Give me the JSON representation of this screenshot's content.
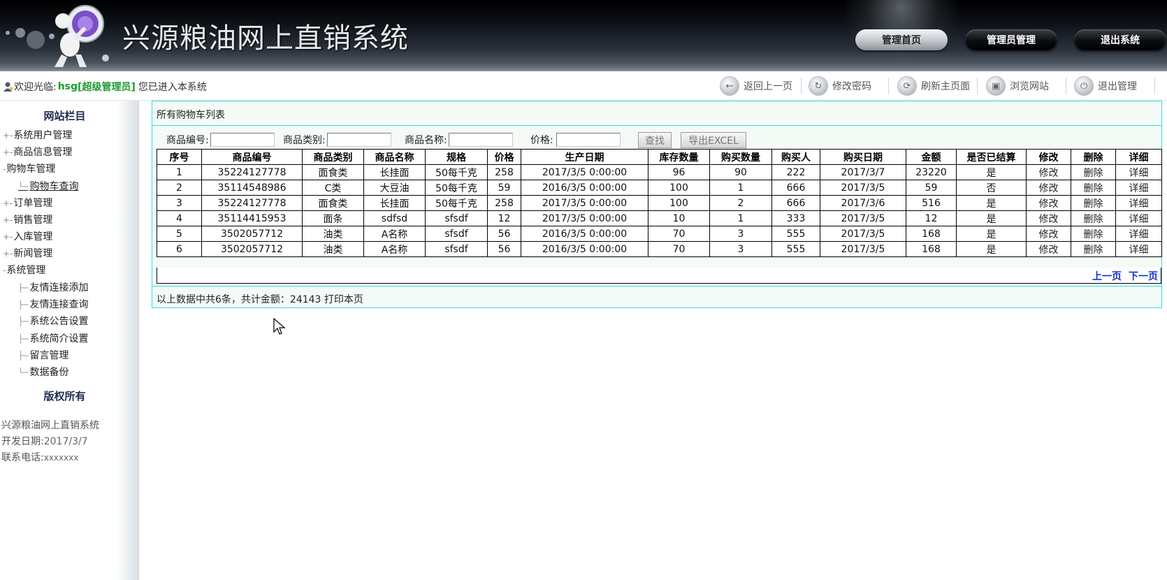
{
  "header": {
    "title": "兴源粮油网上直销系统",
    "nav": [
      "管理首页",
      "管理员管理",
      "退出系统"
    ]
  },
  "infobar": {
    "welcome_prefix": "欢迎光临:",
    "username": "hsg",
    "role": "[超级管理员]",
    "welcome_suffix": "您已进入本系统",
    "tools": [
      {
        "label": "返回上一页",
        "icon": "back-arrow-icon"
      },
      {
        "label": "修改密码",
        "icon": "refresh-key-icon"
      },
      {
        "label": "刷新主页面",
        "icon": "refresh-icon"
      },
      {
        "label": "浏览网站",
        "icon": "browse-icon"
      },
      {
        "label": "退出管理",
        "icon": "power-icon"
      }
    ]
  },
  "sidebar": {
    "title": "网站栏目",
    "items": [
      "系统用户管理",
      "商品信息管理",
      "购物车管理",
      "购物车查询",
      "订单管理",
      "销售管理",
      "入库管理",
      "新闻管理",
      "系统管理"
    ],
    "sub_items": [
      "友情连接添加",
      "友情连接查询",
      "系统公告设置",
      "系统简介设置",
      "留言管理",
      "数据备份"
    ],
    "copyright": "版权所有",
    "footer": {
      "system": "兴源粮油网上直销系统",
      "dev_date_label": "开发日期:",
      "dev_date": "2017/3/7",
      "phone_label": "联系电话:",
      "phone": "xxxxxxx"
    }
  },
  "main": {
    "panel_title": "所有购物车列表",
    "search": {
      "fields": [
        "商品编号:",
        "商品类别:",
        "商品名称:",
        "价格:"
      ],
      "search_button": "查找",
      "export_button": "导出EXCEL"
    },
    "table": {
      "columns": [
        "序号",
        "商品编号",
        "商品类别",
        "商品名称",
        "规格",
        "价格",
        "生产日期",
        "库存数量",
        "购买数量",
        "购买人",
        "购买日期",
        "金额",
        "是否已结算",
        "修改",
        "删除",
        "详细"
      ],
      "rows": [
        [
          "1",
          "35224127778",
          "面食类",
          "长挂面",
          "50每千克",
          "258",
          "2017/3/5 0:00:00",
          "96",
          "90",
          "222",
          "2017/3/7",
          "23220",
          "是",
          "修改",
          "删除",
          "详细"
        ],
        [
          "2",
          "35114548986",
          "C类",
          "大豆油",
          "50每千克",
          "59",
          "2016/3/5 0:00:00",
          "100",
          "1",
          "666",
          "2017/3/5",
          "59",
          "否",
          "修改",
          "删除",
          "详细"
        ],
        [
          "3",
          "35224127778",
          "面食类",
          "长挂面",
          "50每千克",
          "258",
          "2017/3/5 0:00:00",
          "100",
          "2",
          "666",
          "2017/3/6",
          "516",
          "是",
          "修改",
          "删除",
          "详细"
        ],
        [
          "4",
          "35114415953",
          "面条",
          "sdfsd",
          "sfsdf",
          "12",
          "2017/3/5 0:00:00",
          "10",
          "1",
          "333",
          "2017/3/5",
          "12",
          "是",
          "修改",
          "删除",
          "详细"
        ],
        [
          "5",
          "3502057712",
          "油类",
          "A名称",
          "sfsdf",
          "56",
          "2016/3/5 0:00:00",
          "70",
          "3",
          "555",
          "2017/3/5",
          "168",
          "是",
          "修改",
          "删除",
          "详细"
        ],
        [
          "6",
          "3502057712",
          "油类",
          "A名称",
          "sfsdf",
          "56",
          "2016/3/5 0:00:00",
          "70",
          "3",
          "555",
          "2017/3/5",
          "168",
          "是",
          "修改",
          "删除",
          "详细"
        ]
      ]
    },
    "pager": {
      "prev": "上一页",
      "next": "下一页"
    },
    "summary": {
      "text": "以上数据中共6条，共计金额：24143",
      "print": "打印本页"
    }
  },
  "colors": {
    "accent_cyan": "#3fd9e0",
    "welcome_green": "#1f9a33",
    "pager_blue": "#1533cc"
  }
}
